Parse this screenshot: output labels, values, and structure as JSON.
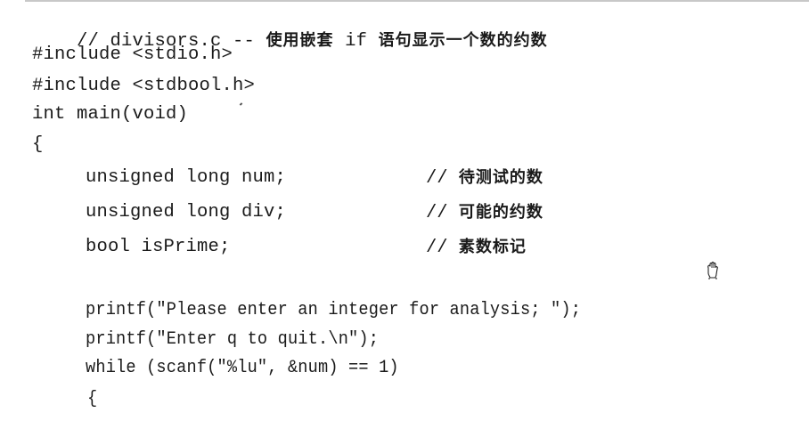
{
  "document": {
    "header_comment": {
      "prefix": "// divisors.c -- ",
      "cjk_a": "使用嵌套",
      "keyword": " if ",
      "cjk_b": "语句显示一个数的约数"
    },
    "lines": [
      "#include <stdio.h>",
      "#include <stdbool.h>",
      "int main(void)",
      "{"
    ],
    "declarations": [
      {
        "code": "unsigned long num;",
        "comment_prefix": "// ",
        "comment": "待测试的数"
      },
      {
        "code": "unsigned long div;",
        "comment_prefix": "// ",
        "comment": "可能的约数"
      },
      {
        "code": "bool isPrime;",
        "comment_prefix": "// ",
        "comment": "素数标记"
      }
    ],
    "body_lines": [
      "printf(\"Please enter an integer for analysis; \");",
      "printf(\"Enter q to quit.\\n\");",
      "while (scanf(\"%lu\", &num) == 1)",
      "{"
    ]
  },
  "cursor": {
    "icon": "hand-grab-icon"
  }
}
